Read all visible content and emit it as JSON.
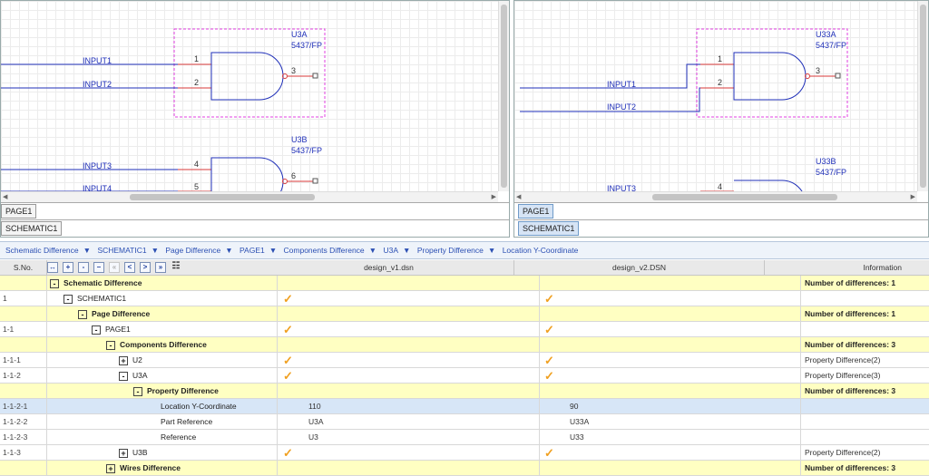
{
  "left_pane": {
    "u3a": {
      "ref": "U3A",
      "part": "5437/FP"
    },
    "u3b": {
      "ref": "U3B",
      "part": "5437/FP"
    },
    "nets": [
      "INPUT1",
      "INPUT2",
      "INPUT3",
      "INPUT4"
    ],
    "pins": [
      "1",
      "2",
      "3",
      "4",
      "5",
      "6"
    ],
    "tab_page": "PAGE1",
    "tab_schematic": "SCHEMATIC1"
  },
  "right_pane": {
    "u33a": {
      "ref": "U33A",
      "part": "5437/FP"
    },
    "u33b": {
      "ref": "U33B",
      "part": "5437/FP"
    },
    "nets": [
      "INPUT1",
      "INPUT2",
      "INPUT3"
    ],
    "pins": [
      "1",
      "2",
      "3",
      "4"
    ],
    "tab_page": "PAGE1",
    "tab_schematic": "SCHEMATIC1"
  },
  "breadcrumb": [
    "Schematic Difference",
    "SCHEMATIC1",
    "Page Difference",
    "PAGE1",
    "Components Difference",
    "U3A",
    "Property Difference",
    "Location Y-Coordinate"
  ],
  "grid": {
    "headers": {
      "sno": "S.No.",
      "v1": "design_v1.dsn",
      "v2": "design_v2.DSN",
      "info": "Information"
    },
    "toolbar": [
      "+/-",
      "+",
      "-",
      "-",
      "<",
      ">",
      ">>",
      "filter"
    ],
    "rows": [
      {
        "sno": "",
        "name": "Schematic Difference",
        "exp": "-",
        "indent": 0,
        "type": "group",
        "v1": "",
        "v2": "",
        "info": "Number of differences: 1"
      },
      {
        "sno": "1",
        "name": "SCHEMATIC1",
        "exp": "-",
        "indent": 1,
        "type": "item",
        "v1": "check",
        "v2": "check",
        "info": ""
      },
      {
        "sno": "",
        "name": "Page Difference",
        "exp": "-",
        "indent": 2,
        "type": "group",
        "v1": "",
        "v2": "",
        "info": "Number of differences: 1"
      },
      {
        "sno": "1-1",
        "name": "PAGE1",
        "exp": "-",
        "indent": 3,
        "type": "item",
        "v1": "check",
        "v2": "check",
        "info": ""
      },
      {
        "sno": "",
        "name": "Components Difference",
        "exp": "-",
        "indent": 4,
        "type": "group",
        "v1": "",
        "v2": "",
        "info": "Number of differences: 3"
      },
      {
        "sno": "1-1-1",
        "name": "U2",
        "exp": "+",
        "indent": 5,
        "type": "item",
        "v1": "check",
        "v2": "check",
        "info": "Property Difference(2)"
      },
      {
        "sno": "1-1-2",
        "name": "U3A",
        "exp": "-",
        "indent": 5,
        "type": "item",
        "v1": "check",
        "v2": "check",
        "info": "Property Difference(3)"
      },
      {
        "sno": "",
        "name": "Property Difference",
        "exp": "-",
        "indent": 6,
        "type": "group",
        "v1": "",
        "v2": "",
        "info": "Number of differences: 3"
      },
      {
        "sno": "1-1-2-1",
        "name": "Location Y-Coordinate",
        "exp": "",
        "indent": 7,
        "type": "selected",
        "v1": "110",
        "v2": "90",
        "info": ""
      },
      {
        "sno": "1-1-2-2",
        "name": "Part Reference",
        "exp": "",
        "indent": 7,
        "type": "item",
        "v1": "U3A",
        "v2": "U33A",
        "info": ""
      },
      {
        "sno": "1-1-2-3",
        "name": "Reference",
        "exp": "",
        "indent": 7,
        "type": "item",
        "v1": "U3",
        "v2": "U33",
        "info": ""
      },
      {
        "sno": "1-1-3",
        "name": "U3B",
        "exp": "+",
        "indent": 5,
        "type": "item",
        "v1": "check",
        "v2": "check",
        "info": "Property Difference(2)"
      },
      {
        "sno": "",
        "name": "Wires Difference",
        "exp": "+",
        "indent": 4,
        "type": "group",
        "v1": "",
        "v2": "",
        "info": "Number of differences: 3"
      }
    ]
  },
  "colors": {
    "wire": "#1f2fb8",
    "pin": "#d83a3a",
    "bbox": "#e040e0",
    "check": "#f0a020",
    "group_bg": "#ffffc2",
    "selected_bg": "#d7e6f7"
  }
}
